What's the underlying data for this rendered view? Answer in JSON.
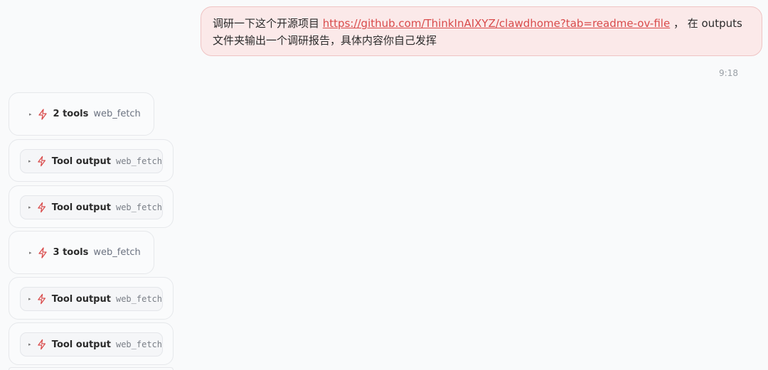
{
  "user_message": {
    "text_before": "调研一下这个开源项目 ",
    "link": "https://github.com/ThinkInAIXYZ/clawdhome?tab=readme-ov-file",
    "text_after": " ， 在 outputs 文件夹输出一个调研报告，具体内容你自己发挥",
    "time": "9:18"
  },
  "colors": {
    "accent": "#d94b4b",
    "bubble_bg": "#fbe9e9",
    "bubble_border": "#efc4c4"
  },
  "tool_items": [
    {
      "kind": "group",
      "caret": "▸",
      "icon": "lightning-icon",
      "label": "2 tools",
      "tool": "web_fetch"
    },
    {
      "kind": "output",
      "caret": "▸",
      "icon": "lightning-icon",
      "label": "Tool output",
      "tool": "web_fetch"
    },
    {
      "kind": "output",
      "caret": "▸",
      "icon": "lightning-icon",
      "label": "Tool output",
      "tool": "web_fetch"
    },
    {
      "kind": "group",
      "caret": "▸",
      "icon": "lightning-icon",
      "label": "3 tools",
      "tool": "web_fetch"
    },
    {
      "kind": "output",
      "caret": "▸",
      "icon": "lightning-icon",
      "label": "Tool output",
      "tool": "web_fetch"
    },
    {
      "kind": "output",
      "caret": "▸",
      "icon": "lightning-icon",
      "label": "Tool output",
      "tool": "web_fetch"
    }
  ]
}
